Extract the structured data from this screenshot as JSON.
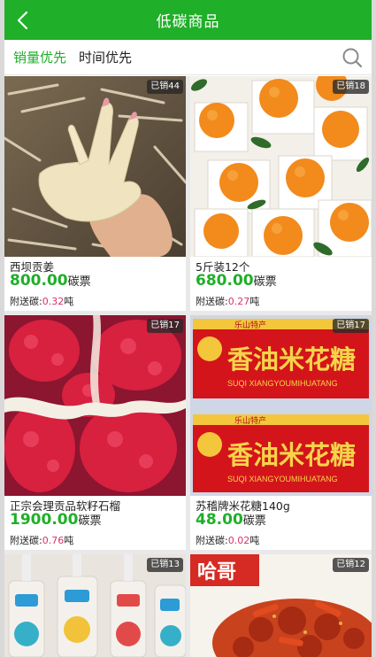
{
  "colors": {
    "primary": "#1faf28",
    "red": "#d6336c",
    "badge_bg": "#333333"
  },
  "header": {
    "title": "低碳商品",
    "back_icon": "chevron-left-icon"
  },
  "tabs": [
    {
      "label": "销量优先",
      "active": true
    },
    {
      "label": "时间优先",
      "active": false
    }
  ],
  "search": {
    "icon": "search-icon"
  },
  "products": [
    {
      "name": "西坝贡姜",
      "price": "800.00",
      "unit": "碳票",
      "carbon_prefix": "附送碳:",
      "carbon_value": "0.32",
      "carbon_unit": "吨",
      "sold": "已销44"
    },
    {
      "name": "5斤装12个",
      "price": "680.00",
      "unit": "碳票",
      "carbon_prefix": "附送碳:",
      "carbon_value": "0.27",
      "carbon_unit": "吨",
      "sold": "已销18"
    },
    {
      "name": "正宗会理贡品软籽石榴",
      "price": "1900.00",
      "unit": "碳票",
      "carbon_prefix": "附送碳:",
      "carbon_value": "0.76",
      "carbon_unit": "吨",
      "sold": "已销17"
    },
    {
      "name": "苏稽牌米花糖140g",
      "price": "48.00",
      "unit": "碳票",
      "carbon_prefix": "附送碳:",
      "carbon_value": "0.02",
      "carbon_unit": "吨",
      "sold": "已销17"
    },
    {
      "sold": "已销13"
    },
    {
      "sold": "已销12",
      "image_text": "哈哥"
    }
  ],
  "candy_box_text": {
    "origin": "乐山特产",
    "brand": "香油米花糖",
    "pinyin": "SUQI XIANGYOUMIHUATANG"
  }
}
